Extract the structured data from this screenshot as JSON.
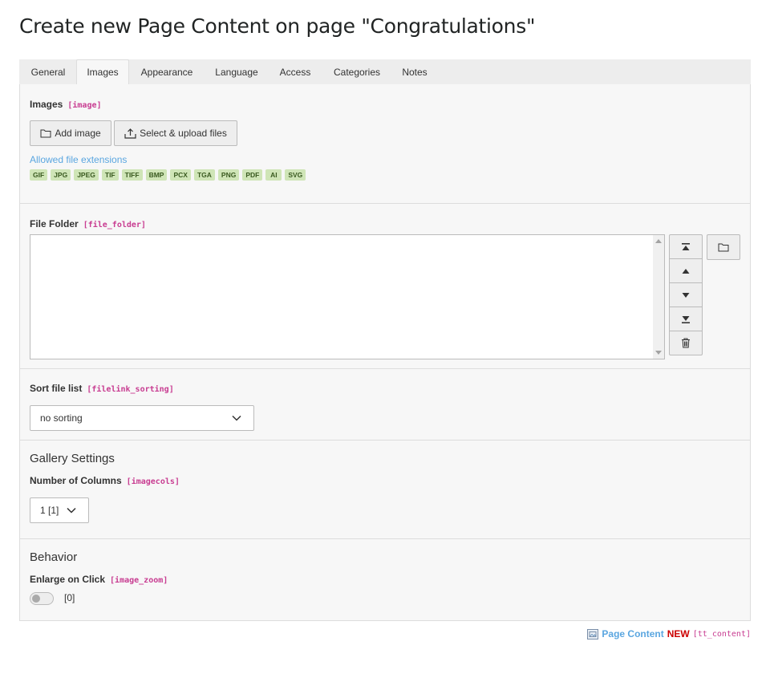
{
  "page": {
    "title": "Create new Page Content on page \"Congratulations\""
  },
  "tabs": [
    {
      "label": "General",
      "active": false
    },
    {
      "label": "Images",
      "active": true
    },
    {
      "label": "Appearance",
      "active": false
    },
    {
      "label": "Language",
      "active": false
    },
    {
      "label": "Access",
      "active": false
    },
    {
      "label": "Categories",
      "active": false
    },
    {
      "label": "Notes",
      "active": false
    }
  ],
  "images_field": {
    "label": "Images",
    "key": "[image]",
    "add_image_label": "Add image",
    "upload_label": "Select & upload files",
    "allowed_link": "Allowed file extensions",
    "extensions": [
      "GIF",
      "JPG",
      "JPEG",
      "TIF",
      "TIFF",
      "BMP",
      "PCX",
      "TGA",
      "PNG",
      "PDF",
      "AI",
      "SVG"
    ]
  },
  "file_folder": {
    "label": "File Folder",
    "key": "[file_folder]",
    "controls": [
      "move-to-top-icon",
      "move-up-icon",
      "move-down-icon",
      "move-to-bottom-icon",
      "trash-icon"
    ],
    "browse_icon": "folder-icon"
  },
  "sort_field": {
    "label": "Sort file list",
    "key": "[filelink_sorting]",
    "value": "no sorting"
  },
  "gallery": {
    "title": "Gallery Settings",
    "columns_label": "Number of Columns",
    "columns_key": "[imagecols]",
    "columns_value": "1 [1]"
  },
  "behavior": {
    "title": "Behavior",
    "enlarge_label": "Enlarge on Click",
    "enlarge_key": "[image_zoom]",
    "toggle_value": "[0]",
    "toggle_on": false
  },
  "footer": {
    "record_label": "Page Content",
    "new_label": "NEW",
    "table_key": "[tt_content]"
  },
  "colors": {
    "link": "#5aa6e0",
    "key_accent": "#c83c91",
    "new_red": "#cc0000",
    "extension_badge": "#cfe5b7"
  }
}
